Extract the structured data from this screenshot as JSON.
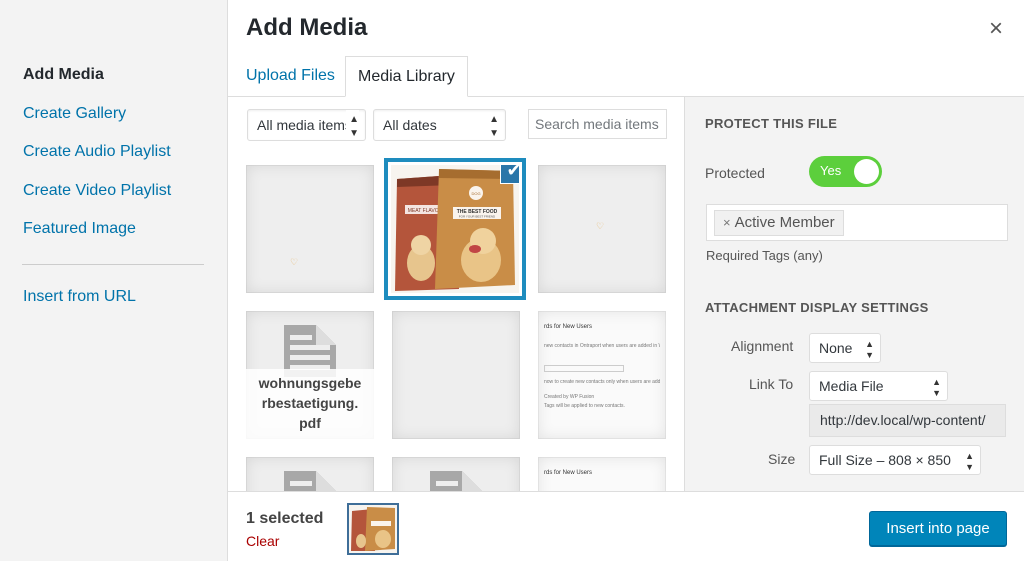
{
  "menu": {
    "items": [
      {
        "label": "Add Media",
        "active": true
      },
      {
        "label": "Create Gallery"
      },
      {
        "label": "Create Audio Playlist"
      },
      {
        "label": "Create Video Playlist"
      },
      {
        "label": "Featured Image"
      }
    ],
    "insert_from_url": "Insert from URL"
  },
  "modal": {
    "title": "Add Media",
    "close_icon": "close-icon",
    "tabs": [
      {
        "label": "Upload Files",
        "active": false
      },
      {
        "label": "Media Library",
        "active": true
      }
    ]
  },
  "toolbar": {
    "type_filter": "All media items",
    "date_filter": "All dates",
    "search_placeholder": "Search media items..."
  },
  "grid": {
    "doc_filename": "wohnungsgebe rbestaetigung. pdf",
    "doc_filename_lines": [
      "wohnungsgebe",
      "rbestaetigung.",
      "pdf"
    ],
    "screenshot_texts": {
      "heading": "rds for New Users",
      "line1": "new contacts in Ontraport when users are added in WordP",
      "line2": "now to create new contacts only when users are added to sp",
      "line3": "Created by WP Fusion",
      "line4": "Tags will be applied to new contacts."
    },
    "product_texts": {
      "left_bag": "MEAT FLAVOR",
      "right_bag": "THE BEST FOOD",
      "right_sub": "FOR YOUR BEST FRIEND",
      "brand": "DOG"
    }
  },
  "bottom": {
    "selected_count": "1 selected",
    "clear_label": "Clear",
    "insert_label": "Insert into page"
  },
  "sidebar": {
    "protect_title": "PROTECT THIS FILE",
    "protected_label": "Protected",
    "protected_value": "Yes",
    "tag": "Active Member",
    "required_tags_label": "Required Tags (any)",
    "display_title": "ATTACHMENT DISPLAY SETTINGS",
    "alignment_label": "Alignment",
    "alignment_value": "None",
    "link_to_label": "Link To",
    "link_to_value": "Media File",
    "url_value": "http://dev.local/wp-content/",
    "size_label": "Size",
    "size_value": "Full Size – 808 × 850"
  },
  "colors": {
    "link": "#0073aa",
    "selected_border": "#1e8cbe",
    "toggle_on": "#5ccf3c",
    "button_primary": "#0085ba",
    "clear_link": "#a00000"
  }
}
